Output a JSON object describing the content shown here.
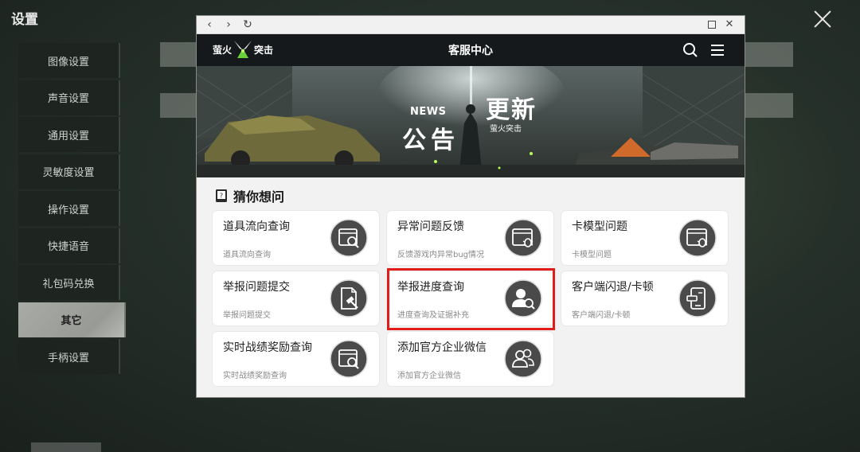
{
  "game": {
    "title": "设置",
    "menu": [
      "图像设置",
      "声音设置",
      "通用设置",
      "灵敏度设置",
      "操作设置",
      "快捷语音",
      "礼包码兑换",
      "其它",
      "手柄设置"
    ],
    "active_index": 7
  },
  "browser": {
    "nav": {
      "back": "‹",
      "forward": "›",
      "reload": "↻"
    },
    "window": {
      "close": "✕"
    }
  },
  "site": {
    "logo_left": "萤火",
    "logo_right": "突击",
    "title": "客服中心",
    "icons": [
      "search-icon",
      "menu-icon"
    ]
  },
  "banner": {
    "news": "NEWS",
    "gonggao": "公告",
    "gengxin": "更新",
    "sub": "萤火突击"
  },
  "section": {
    "title": "猜你想问"
  },
  "cards": [
    {
      "title": "道具流向查询",
      "subtitle": "道具流向查询",
      "icon": "web-search-icon"
    },
    {
      "title": "异常问题反馈",
      "subtitle": "反馈游戏内异常bug情况",
      "icon": "web-bug-icon"
    },
    {
      "title": "卡模型问题",
      "subtitle": "卡模型问题",
      "icon": "web-bug-icon"
    },
    {
      "title": "举报问题提交",
      "subtitle": "举报问题提交",
      "icon": "document-hammer-icon"
    },
    {
      "title": "举报进度查询",
      "subtitle": "进度查询及证据补充",
      "icon": "user-search-icon"
    },
    {
      "title": "客户端闪退/卡顿",
      "subtitle": "客户端闪退/卡顿",
      "icon": "mobile-device-icon"
    },
    {
      "title": "实时战绩奖励查询",
      "subtitle": "实时战绩奖励查询",
      "icon": "web-search-icon"
    },
    {
      "title": "添加官方企业微信",
      "subtitle": "添加官方企业微信",
      "icon": "users-icon"
    }
  ],
  "colors": {
    "header_bg": "#16191b",
    "highlight": "#e21b1b",
    "icon_bg": "#4a4a4a"
  }
}
